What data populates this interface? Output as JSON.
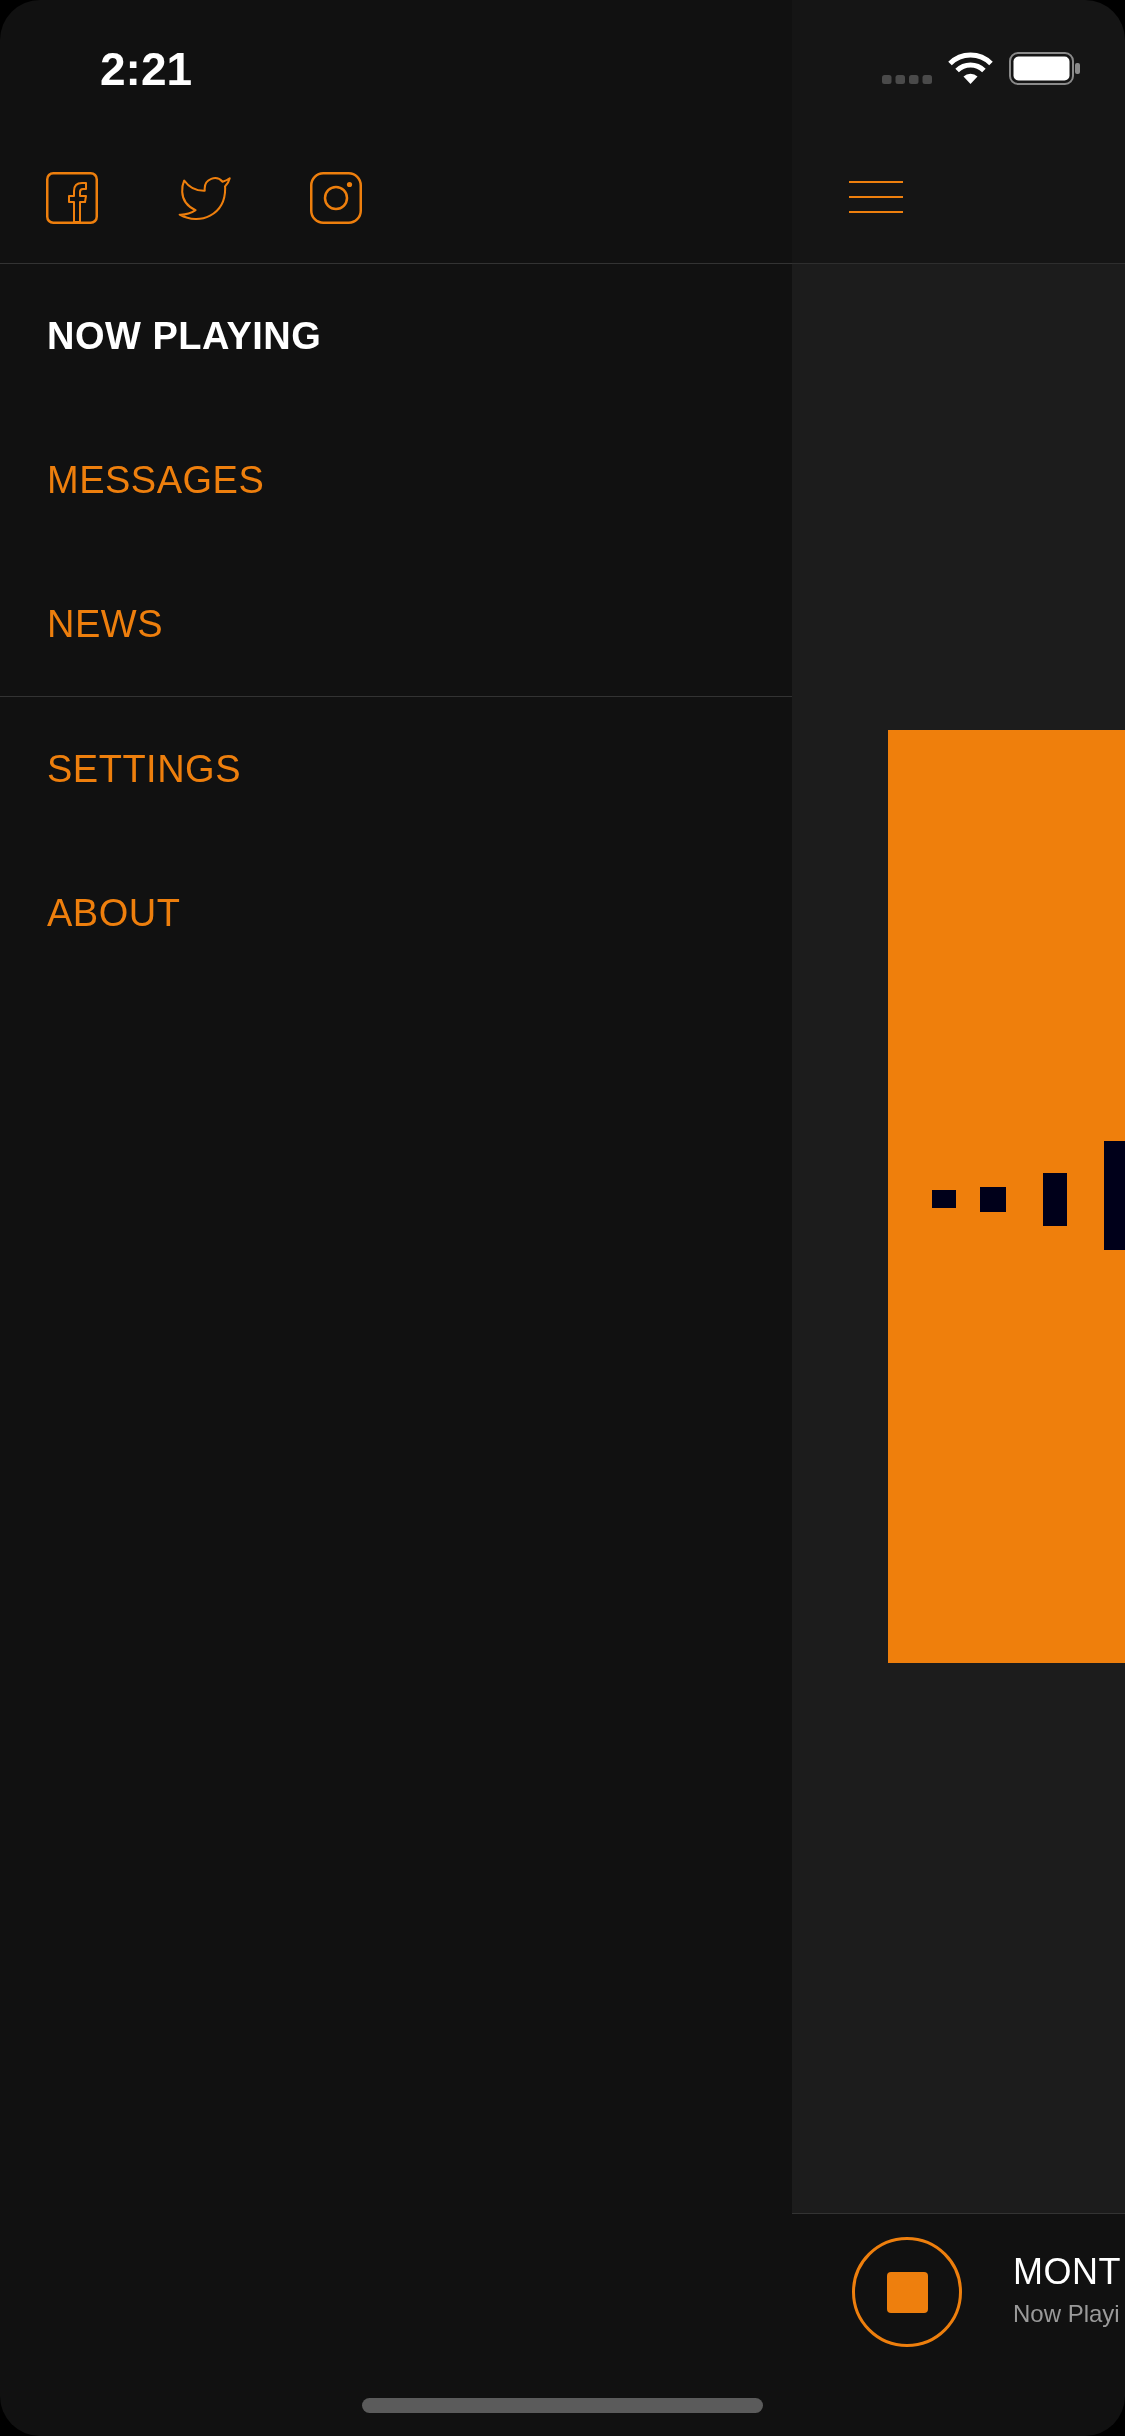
{
  "status_bar": {
    "time": "2:21"
  },
  "drawer": {
    "social_links": [
      {
        "kind": "facebook"
      },
      {
        "kind": "twitter"
      },
      {
        "kind": "instagram"
      }
    ],
    "menu": {
      "sections": [
        {
          "items": [
            {
              "label": "NOW PLAYING",
              "selected": true
            },
            {
              "label": "MESSAGES",
              "selected": false
            },
            {
              "label": "NEWS",
              "selected": false
            }
          ]
        },
        {
          "items": [
            {
              "label": "SETTINGS",
              "selected": false
            },
            {
              "label": "ABOUT",
              "selected": false
            }
          ]
        }
      ]
    }
  },
  "player": {
    "title": "MONT",
    "subtitle": "Now Playi",
    "playing": true
  }
}
